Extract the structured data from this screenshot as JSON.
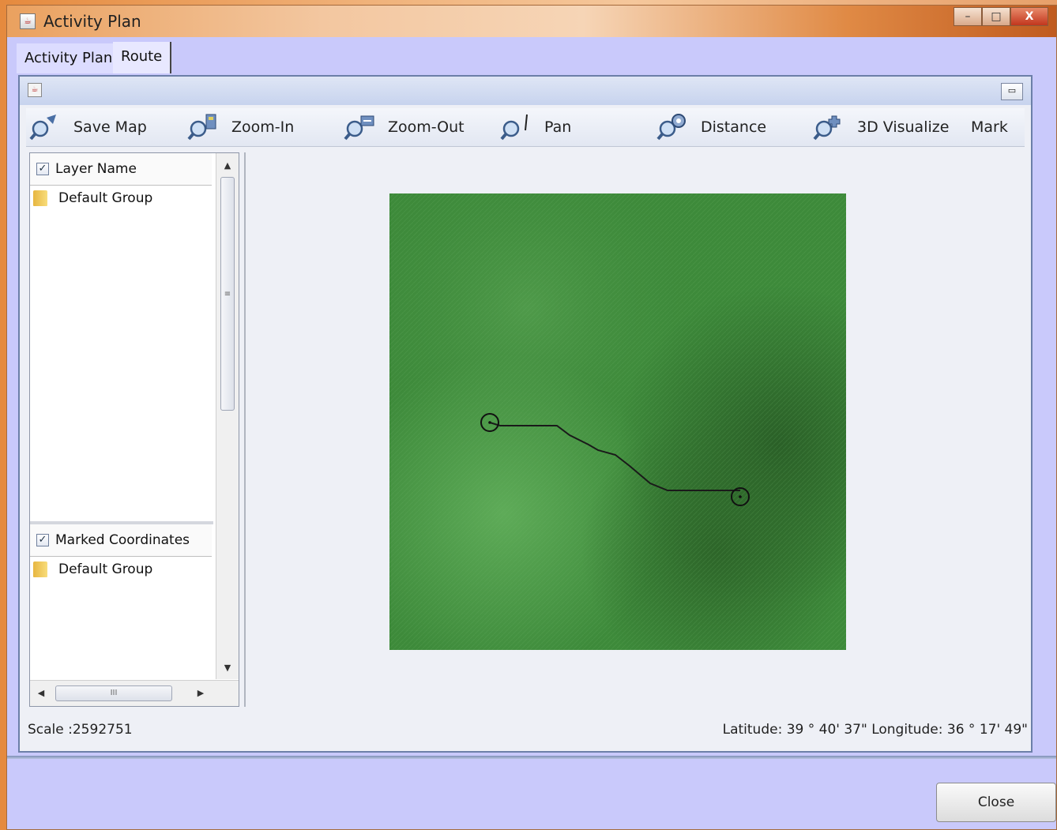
{
  "window": {
    "title": "Activity Plan",
    "minimize": "–",
    "maximize": "□",
    "close": "X"
  },
  "tabs": [
    {
      "label": "Activity Plan",
      "active": false
    },
    {
      "label": "Route",
      "active": true
    }
  ],
  "toolbar": {
    "items": [
      {
        "label": "Save Map",
        "icon": "save-map-icon"
      },
      {
        "label": "Zoom-In",
        "icon": "zoom-in-icon"
      },
      {
        "label": "Zoom-Out",
        "icon": "zoom-out-icon"
      },
      {
        "label": "Pan",
        "icon": "pan-icon"
      },
      {
        "label": "Distance",
        "icon": "distance-icon"
      },
      {
        "label": "3D Visualize",
        "icon": "3d-visualize-icon"
      },
      {
        "label": "Mark"
      }
    ]
  },
  "layers": {
    "header": "Layer Name",
    "header_checked": true,
    "group": "Default Group"
  },
  "marked": {
    "header": "Marked Coordinates",
    "header_checked": true,
    "group": "Default Group"
  },
  "scroll": {
    "v_grip": "≡",
    "h_grip": "III",
    "up": "▲",
    "down": "▼",
    "left": "◀",
    "right": "▶"
  },
  "map": {
    "colors": {
      "dark": "#2f6d2c",
      "mid": "#3e8a3b",
      "light": "#5aa555"
    },
    "route_color": "#1a1a1a"
  },
  "status": {
    "scale": "Scale :2592751",
    "coords": "Latitude: 39 ° 40' 37\" Longitude: 36 ° 17' 49\""
  },
  "buttons": {
    "close": "Close"
  },
  "inner_panel": {
    "icon": "java-icon",
    "restore": "▭"
  }
}
